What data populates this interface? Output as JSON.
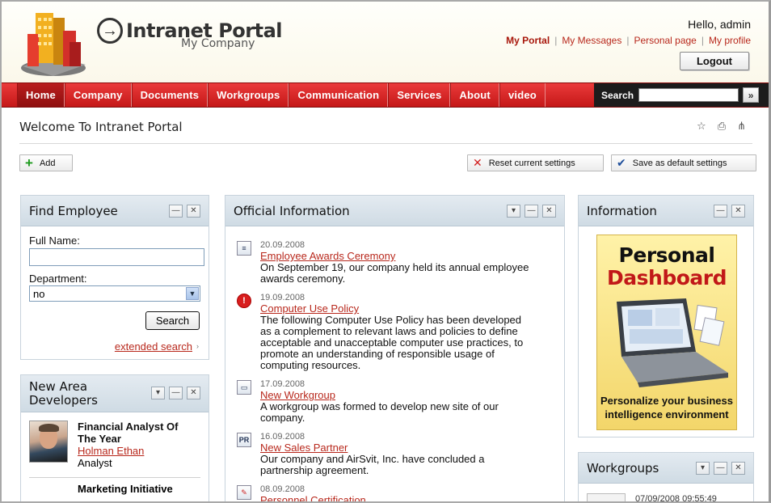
{
  "header": {
    "brand": "Intranet Portal",
    "company": "My Company",
    "greeting": "Hello, admin",
    "links": [
      "My Portal",
      "My Messages",
      "Personal page",
      "My profile"
    ],
    "logout_label": "Logout"
  },
  "nav": {
    "items": [
      "Home",
      "Company",
      "Documents",
      "Workgroups",
      "Communication",
      "Services",
      "About",
      "video"
    ],
    "search_label": "Search",
    "search_go": "»"
  },
  "page": {
    "title": "Welcome To Intranet Portal",
    "add_label": "Add",
    "reset_label": "Reset current settings",
    "save_label": "Save as default settings"
  },
  "find_employee": {
    "title": "Find Employee",
    "full_name_label": "Full Name:",
    "full_name_value": "",
    "department_label": "Department:",
    "department_value": "no",
    "search_button": "Search",
    "extended_link": "extended search"
  },
  "new_area": {
    "title_line1": "New Area",
    "title_line2": "Developers",
    "dev": {
      "title_line1": "Financial Analyst Of",
      "title_line2": "The Year",
      "name": "Holman Ethan",
      "role": "Analyst"
    },
    "next_title": "Marketing Initiative"
  },
  "official": {
    "title": "Official Information",
    "news": [
      {
        "icon": "document-icon",
        "date": "20.09.2008",
        "title": "Employee Awards Ceremony",
        "text": [
          "On September 19, our company held its annual employee",
          "awards ceremony."
        ]
      },
      {
        "icon": "alert-icon",
        "date": "19.09.2008",
        "title": "Computer Use Policy",
        "text": [
          "The following Computer Use Policy has been developed",
          "as a complement to relevant laws and policies to define",
          "acceptable and unacceptable computer use practices, to",
          "promote an understanding of responsible usage of",
          "computing resources."
        ]
      },
      {
        "icon": "computer-icon",
        "date": "17.09.2008",
        "title": "New Workgroup",
        "text": [
          "A workgroup was formed to develop new site of our",
          "company."
        ]
      },
      {
        "icon": "pr-icon",
        "date": "16.09.2008",
        "title": "New Sales Partner",
        "text": [
          "Our company and AirSvit, Inc. have concluded a",
          "partnership agreement."
        ]
      },
      {
        "icon": "certificate-icon",
        "date": "08.09.2008",
        "title": "Personnel Certification",
        "text": []
      }
    ]
  },
  "information": {
    "title": "Information",
    "ad_line1": "Personal",
    "ad_line2": "Dashboard",
    "ad_foot1": "Personalize your business",
    "ad_foot2": "intelligence environment"
  },
  "workgroups": {
    "title": "Workgroups",
    "row_text": "07/09/2008 09:55:49"
  }
}
